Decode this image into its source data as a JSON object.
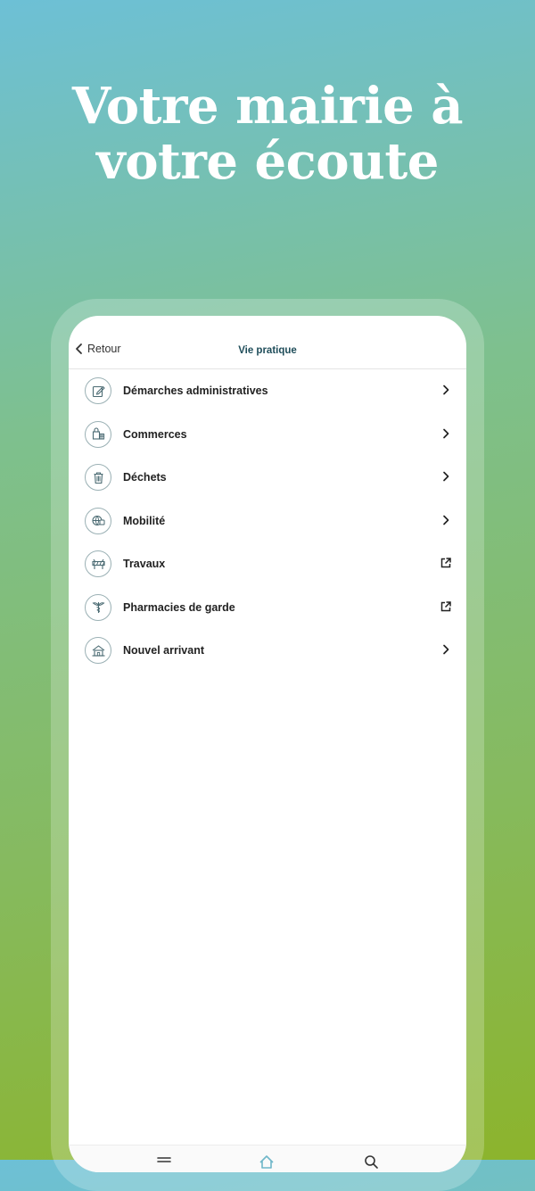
{
  "headline": {
    "line1": "Votre mairie à",
    "line2": "votre écoute"
  },
  "topbar": {
    "back_label": "Retour",
    "title": "Vie pratique"
  },
  "items": [
    {
      "label": "Démarches administratives",
      "icon": "form-edit-icon",
      "trailing": "chevron-right-icon"
    },
    {
      "label": "Commerces",
      "icon": "shop-icon",
      "trailing": "chevron-right-icon"
    },
    {
      "label": "Déchets",
      "icon": "trash-bin-icon",
      "trailing": "chevron-right-icon"
    },
    {
      "label": "Mobilité",
      "icon": "bike-bus-icon",
      "trailing": "chevron-right-icon"
    },
    {
      "label": "Travaux",
      "icon": "roadwork-barrier-icon",
      "trailing": "external-link-icon"
    },
    {
      "label": "Pharmacies de garde",
      "icon": "pharmacy-caduceus-icon",
      "trailing": "external-link-icon"
    },
    {
      "label": "Nouvel arrivant",
      "icon": "house-icon",
      "trailing": "chevron-right-icon"
    }
  ],
  "bottom_nav": [
    {
      "icon": "menu-icon"
    },
    {
      "icon": "home-icon"
    },
    {
      "icon": "search-icon"
    }
  ],
  "colors": {
    "title": "#1f4d5a",
    "icon_stroke": "#4a6a72",
    "icon_border": "#9ab0b4",
    "active_tab": "#6fb7c9"
  }
}
